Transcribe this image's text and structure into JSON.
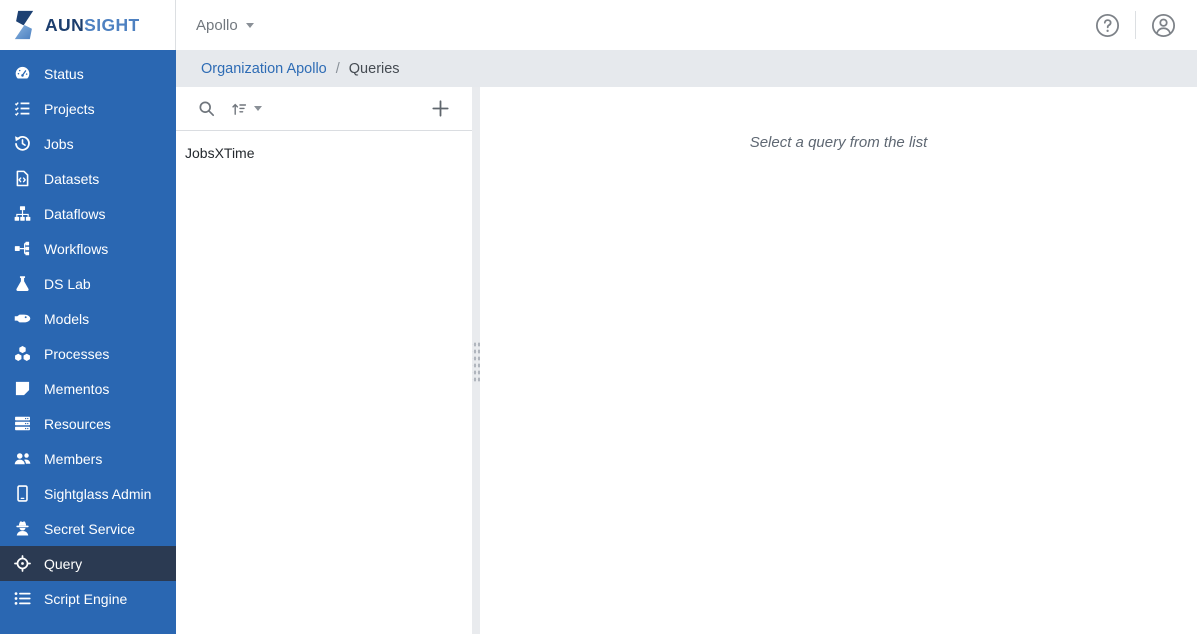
{
  "brand": {
    "wordmark_primary": "AUN",
    "wordmark_secondary": "SIGHT"
  },
  "topbar": {
    "org_selector_label": "Apollo",
    "icons": [
      "help-icon",
      "user-icon"
    ]
  },
  "breadcrumb": {
    "parent": "Organization Apollo",
    "separator": "/",
    "current": "Queries"
  },
  "sidebar": {
    "items": [
      {
        "label": "Status",
        "icon": "gauge-icon",
        "selected": false
      },
      {
        "label": "Projects",
        "icon": "tasks-icon",
        "selected": false
      },
      {
        "label": "Jobs",
        "icon": "history-icon",
        "selected": false
      },
      {
        "label": "Datasets",
        "icon": "file-code-icon",
        "selected": false
      },
      {
        "label": "Dataflows",
        "icon": "sitemap-icon",
        "selected": false
      },
      {
        "label": "Workflows",
        "icon": "workflow-nodes-icon",
        "selected": false
      },
      {
        "label": "DS Lab",
        "icon": "flask-icon",
        "selected": false
      },
      {
        "label": "Models",
        "icon": "shuttle-icon",
        "selected": false
      },
      {
        "label": "Processes",
        "icon": "cubes-icon",
        "selected": false
      },
      {
        "label": "Mementos",
        "icon": "sticky-note-icon",
        "selected": false
      },
      {
        "label": "Resources",
        "icon": "server-icon",
        "selected": false
      },
      {
        "label": "Members",
        "icon": "users-icon",
        "selected": false
      },
      {
        "label": "Sightglass Admin",
        "icon": "tablet-icon",
        "selected": false
      },
      {
        "label": "Secret Service",
        "icon": "spy-icon",
        "selected": false
      },
      {
        "label": "Query",
        "icon": "crosshair-icon",
        "selected": true
      },
      {
        "label": "Script Engine",
        "icon": "bullet-list-icon",
        "selected": false
      }
    ]
  },
  "query_panel": {
    "toolbar_icons": [
      "search-icon",
      "sort-icon",
      "caret-down-icon",
      "plus-icon"
    ],
    "items": [
      {
        "name": "JobsXTime"
      }
    ]
  },
  "main": {
    "empty_state_message": "Select a query from the list"
  },
  "colors": {
    "sidebar_blue": "#2a67b2",
    "sidebar_selected": "#2b3a52",
    "breadcrumb_bg": "#e6e9ed",
    "link_blue": "#2e6cb5",
    "logo_dark": "#1d4173",
    "logo_light": "#4c80c0"
  }
}
